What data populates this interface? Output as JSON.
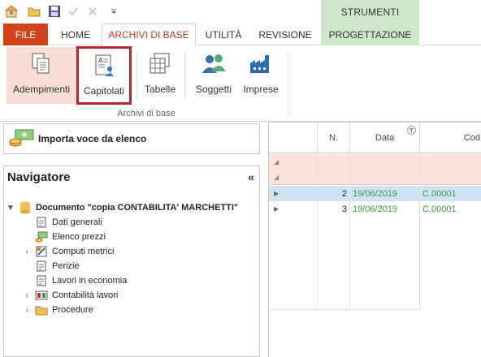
{
  "qat": {
    "icons": [
      "home-icon",
      "open-folder-icon",
      "save-icon",
      "check-icon",
      "close-icon",
      "customize-icon"
    ]
  },
  "context_tab_group": {
    "label": "STRUMENTI"
  },
  "tabs": [
    {
      "label": "FILE"
    },
    {
      "label": "HOME"
    },
    {
      "label": "ARCHIVI DI BASE"
    },
    {
      "label": "UTILITÀ"
    },
    {
      "label": "REVISIONE"
    },
    {
      "label": "PROGETTAZIONE"
    }
  ],
  "ribbon": {
    "buttons": [
      {
        "label": "Adempimenti",
        "icon": "documents-icon"
      },
      {
        "label": "Capitolati",
        "icon": "specs-icon"
      },
      {
        "label": "Tabelle",
        "icon": "tables-icon"
      },
      {
        "label": "Soggetti",
        "icon": "people-icon"
      },
      {
        "label": "Imprese",
        "icon": "factory-icon"
      }
    ],
    "group_label": "Archivi di base"
  },
  "import": {
    "label": "Importa voce da elenco"
  },
  "navigator": {
    "title": "Navigatore",
    "collapse": "«",
    "root": "Documento \"copia CONTABILITA' MARCHETTI\"",
    "items": [
      {
        "label": "Dati generali",
        "icon": "document-icon"
      },
      {
        "label": "Elenco prezzi",
        "icon": "price-list-icon"
      },
      {
        "label": "Computi metrici",
        "icon": "metric-icon"
      },
      {
        "label": "Perizie",
        "icon": "document-icon"
      },
      {
        "label": "Lavori in economia",
        "icon": "document-icon"
      },
      {
        "label": "Contabilità lavori",
        "icon": "accounting-icon"
      },
      {
        "label": "Procedure",
        "icon": "folder-icon"
      }
    ]
  },
  "grid": {
    "columns": [
      "N.",
      "Data",
      "Cod"
    ],
    "rows": [
      {
        "n": "2",
        "data": "19/06/2019",
        "cod": "C.00001"
      },
      {
        "n": "3",
        "data": "19/06/2019",
        "cod": "C.00001"
      }
    ]
  },
  "colors": {
    "file_tab": "#d0431b",
    "accent": "#c0392b",
    "context_tab": "#cfe8cc",
    "selection": "#cfe3f5",
    "filter_row": "#fbe3dc",
    "highlight_border": "#b3282d",
    "green_text": "#3a9a3a"
  }
}
